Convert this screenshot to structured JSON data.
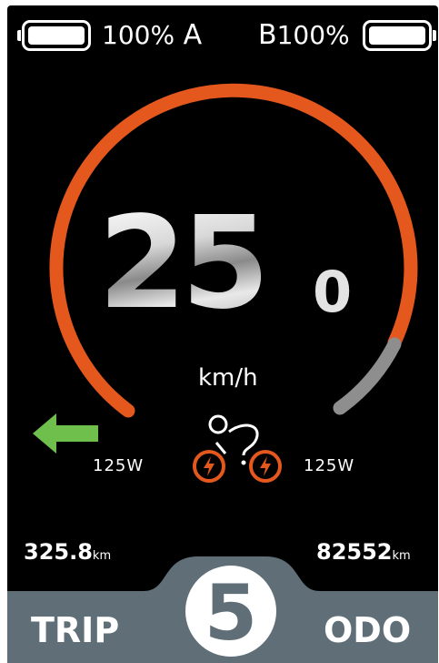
{
  "battery_a": {
    "percent_text": "100%",
    "label": "A",
    "level": 100
  },
  "battery_b": {
    "percent_text": "100%",
    "label": "B",
    "level": 100
  },
  "speed": {
    "integer": "25",
    "decimal": "0",
    "unit": "km/h"
  },
  "power": {
    "left": "125W",
    "right": "125W"
  },
  "trip": {
    "value": "325.8",
    "unit": "km",
    "label": "TRIP"
  },
  "odo": {
    "value": "82552",
    "unit": "km",
    "label": "ODO"
  },
  "assist_level": "5",
  "icons": [
    "battery-icon",
    "left-arrow-icon",
    "bicycle-lightning-icon"
  ],
  "colors": {
    "arc_active": "#e4571d",
    "arc_inactive": "#8e8e8e",
    "arrow": "#6fbf4c",
    "bottom_panel": "#5f6e77"
  }
}
